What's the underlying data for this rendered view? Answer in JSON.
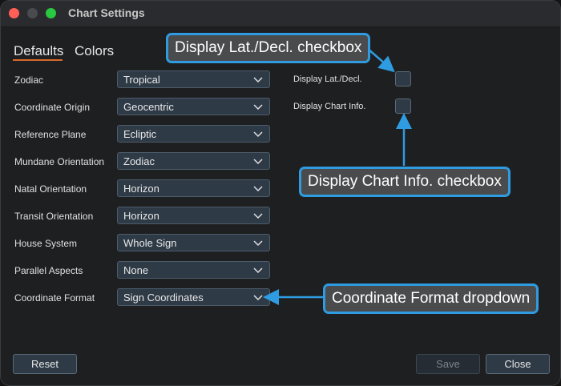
{
  "window": {
    "title": "Chart Settings"
  },
  "tabs": [
    {
      "label": "Defaults"
    },
    {
      "label": "Colors"
    }
  ],
  "settings": [
    {
      "label": "Zodiac",
      "value": "Tropical"
    },
    {
      "label": "Coordinate Origin",
      "value": "Geocentric"
    },
    {
      "label": "Reference Plane",
      "value": "Ecliptic"
    },
    {
      "label": "Mundane Orientation",
      "value": "Zodiac"
    },
    {
      "label": "Natal Orientation",
      "value": "Horizon"
    },
    {
      "label": "Transit Orientation",
      "value": "Horizon"
    },
    {
      "label": "House System",
      "value": "Whole Sign"
    },
    {
      "label": "Parallel Aspects",
      "value": "None"
    },
    {
      "label": "Coordinate Format",
      "value": "Sign Coordinates"
    }
  ],
  "checkboxes": [
    {
      "label": "Display Lat./Decl.",
      "checked": false
    },
    {
      "label": "Display Chart Info.",
      "checked": false
    }
  ],
  "buttons": {
    "reset": "Reset",
    "save": "Save",
    "close": "Close"
  },
  "callouts": {
    "lat_decl": "Display Lat./Decl. checkbox",
    "chart_info": "Display Chart Info. checkbox",
    "coord_format": "Coordinate Format dropdown"
  },
  "colors": {
    "accent_tab": "#d9692b",
    "callout_border": "#2f9be0"
  }
}
